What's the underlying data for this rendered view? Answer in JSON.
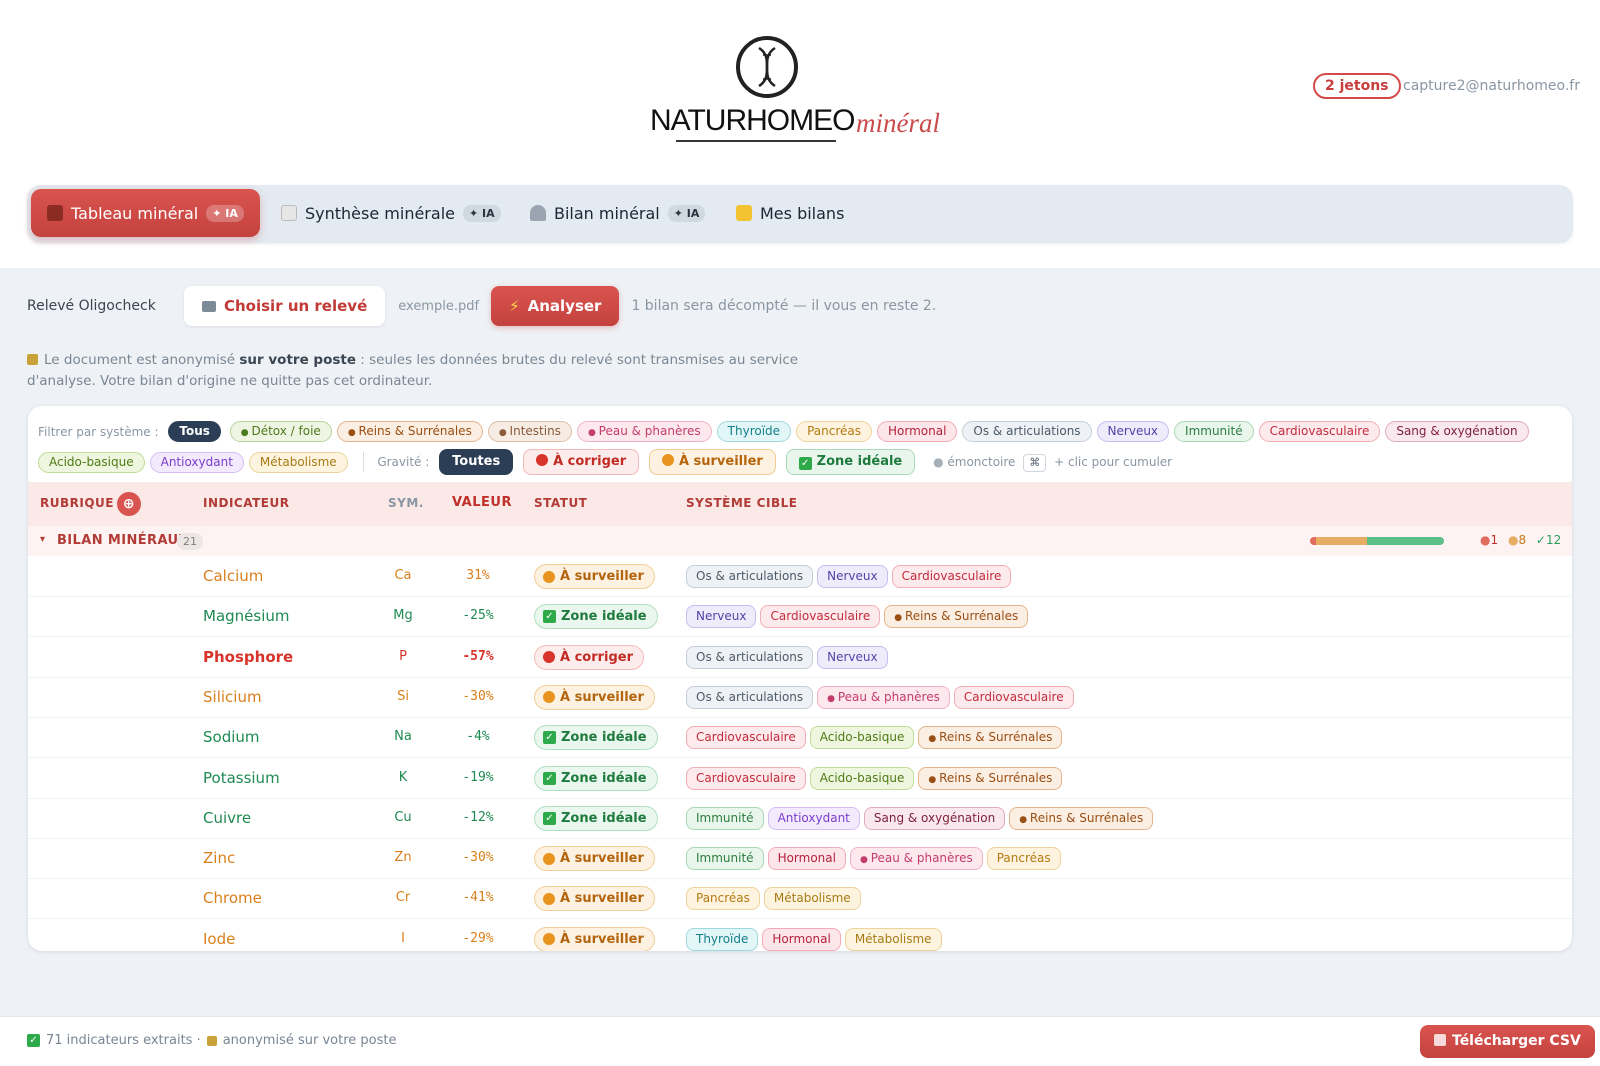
{
  "brand": {
    "name": "NATURHOMEO",
    "sub": "minéral"
  },
  "account": {
    "tokens": "2 jetons",
    "email": "capture2@naturhomeo.fr"
  },
  "tabs": [
    {
      "label": "Tableau minéral",
      "badge": "✦ IA",
      "icon": "grid-icon"
    },
    {
      "label": "Synthèse minérale",
      "badge": "✦ IA",
      "icon": "notepad-icon"
    },
    {
      "label": "Bilan minéral",
      "badge": "✦ IA",
      "icon": "microscope-icon"
    },
    {
      "label": "Mes bilans",
      "badge": "",
      "icon": "folder-icon"
    }
  ],
  "upload": {
    "label": "Relevé Oligocheck",
    "choose": "Choisir un relevé",
    "filename": "exemple.pdf",
    "analyze": "Analyser",
    "remaining": "1 bilan sera décompté — il vous en reste 2."
  },
  "notice": {
    "pre": "Le document est anonymisé ",
    "bold": "sur votre poste",
    "post": " : seules les données brutes du relevé sont transmises au service d'analyse. Votre bilan d'origine ne quitte pas cet ordinateur."
  },
  "filters": {
    "label": "Filtrer par système :",
    "all": "Tous",
    "systems": [
      "Détox / foie",
      "Reins & Surrénales",
      "Intestins",
      "Peau & phanères",
      "Thyroïde",
      "Pancréas",
      "Hormonal",
      "Os & articulations",
      "Nerveux",
      "Immunité",
      "Cardiovasculaire",
      "Sang & oxygénation",
      "Acido-basique",
      "Antioxydant",
      "Métabolisme"
    ],
    "severity_label": "Gravité :",
    "severity_all": "Toutes",
    "sev_corriger": "À corriger",
    "sev_surveiller": "À surveiller",
    "sev_ideale": "Zone idéale",
    "hint_emonctoire": "émonctoire",
    "hint_key": "⌘",
    "hint_cumul": "+ clic pour cumuler"
  },
  "table": {
    "headers": {
      "rubrique": "RUBRIQUE",
      "add": "⊕",
      "indicateur": "INDICATEUR",
      "sym": "SYM.",
      "valeur": "VALEUR",
      "statut": "STATUT",
      "systeme": "SYSTÈME CIBLE"
    },
    "group": {
      "name": "BILAN MINÉRAUX",
      "count": "21",
      "stat_red": "1",
      "stat_orange": "8",
      "stat_green": "✓12"
    },
    "rows": [
      {
        "name": "Calcium",
        "sym": "Ca",
        "value": "31%",
        "status": "À surveiller",
        "level": "warn",
        "systems": [
          "Os & articulations",
          "Nerveux",
          "Cardiovasculaire"
        ]
      },
      {
        "name": "Magnésium",
        "sym": "Mg",
        "value": "-25%",
        "status": "Zone idéale",
        "level": "ok",
        "systems": [
          "Nerveux",
          "Cardiovasculaire",
          "Reins & Surrénales"
        ]
      },
      {
        "name": "Phosphore",
        "sym": "P",
        "value": "-57%",
        "status": "À corriger",
        "level": "bad",
        "systems": [
          "Os & articulations",
          "Nerveux"
        ]
      },
      {
        "name": "Silicium",
        "sym": "Si",
        "value": "-30%",
        "status": "À surveiller",
        "level": "warn",
        "systems": [
          "Os & articulations",
          "Peau & phanères",
          "Cardiovasculaire"
        ]
      },
      {
        "name": "Sodium",
        "sym": "Na",
        "value": "-4%",
        "status": "Zone idéale",
        "level": "ok",
        "systems": [
          "Cardiovasculaire",
          "Acido-basique",
          "Reins & Surrénales"
        ]
      },
      {
        "name": "Potassium",
        "sym": "K",
        "value": "-19%",
        "status": "Zone idéale",
        "level": "ok",
        "systems": [
          "Cardiovasculaire",
          "Acido-basique",
          "Reins & Surrénales"
        ]
      },
      {
        "name": "Cuivre",
        "sym": "Cu",
        "value": "-12%",
        "status": "Zone idéale",
        "level": "ok",
        "systems": [
          "Immunité",
          "Antioxydant",
          "Sang & oxygénation",
          "Reins & Surrénales"
        ]
      },
      {
        "name": "Zinc",
        "sym": "Zn",
        "value": "-30%",
        "status": "À surveiller",
        "level": "warn",
        "systems": [
          "Immunité",
          "Hormonal",
          "Peau & phanères",
          "Pancréas"
        ]
      },
      {
        "name": "Chrome",
        "sym": "Cr",
        "value": "-41%",
        "status": "À surveiller",
        "level": "warn",
        "systems": [
          "Pancréas",
          "Métabolisme"
        ]
      },
      {
        "name": "Iode",
        "sym": "I",
        "value": "-29%",
        "status": "À surveiller",
        "level": "warn",
        "systems": [
          "Thyroïde",
          "Hormonal",
          "Métabolisme"
        ]
      }
    ]
  },
  "footer": {
    "extracted": "71 indicateurs extraits ·",
    "anon": "anonymisé sur votre poste",
    "csv": "Télécharger CSV"
  },
  "colors": {
    "accent": "#c94b4b",
    "warn": "#e08a1e",
    "ok": "#2e9e5e",
    "bad": "#d9342b"
  }
}
